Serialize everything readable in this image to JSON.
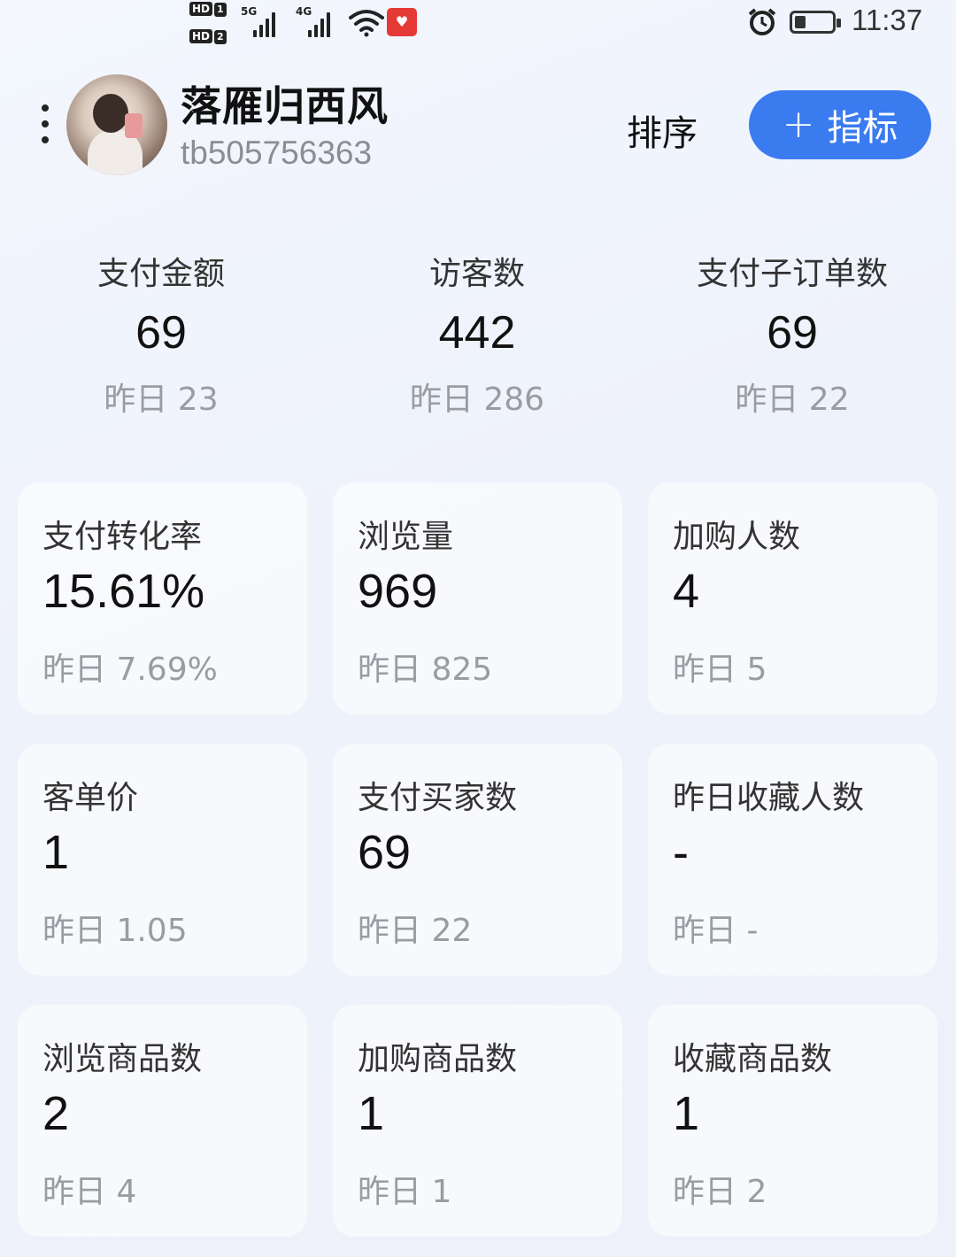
{
  "status_bar": {
    "hd1": "HD",
    "hd1_num": "1",
    "hd2": "HD",
    "hd2_num": "2",
    "sim1_label": "5G",
    "sim2_label": "4G",
    "time": "11:37"
  },
  "header": {
    "username": "落雁归西风",
    "user_id": "tb505756363",
    "sort_label": "排序",
    "add_label": "指标",
    "add_icon": "+"
  },
  "top_metrics": [
    {
      "label": "支付金额",
      "value": "69",
      "yesterday": "昨日 23"
    },
    {
      "label": "访客数",
      "value": "442",
      "yesterday": "昨日 286"
    },
    {
      "label": "支付子订单数",
      "value": "69",
      "yesterday": "昨日 22"
    }
  ],
  "cards": [
    {
      "label": "支付转化率",
      "value": "15.61%",
      "yesterday": "昨日 7.69%"
    },
    {
      "label": "浏览量",
      "value": "969",
      "yesterday": "昨日 825"
    },
    {
      "label": "加购人数",
      "value": "4",
      "yesterday": "昨日 5"
    },
    {
      "label": "客单价",
      "value": "1",
      "yesterday": "昨日 1.05"
    },
    {
      "label": "支付买家数",
      "value": "69",
      "yesterday": "昨日 22"
    },
    {
      "label": "昨日收藏人数",
      "value": "-",
      "yesterday": "昨日 -"
    },
    {
      "label": "浏览商品数",
      "value": "2",
      "yesterday": "昨日 4"
    },
    {
      "label": "加购商品数",
      "value": "1",
      "yesterday": "昨日 1"
    },
    {
      "label": "收藏商品数",
      "value": "1",
      "yesterday": "昨日 2"
    }
  ]
}
